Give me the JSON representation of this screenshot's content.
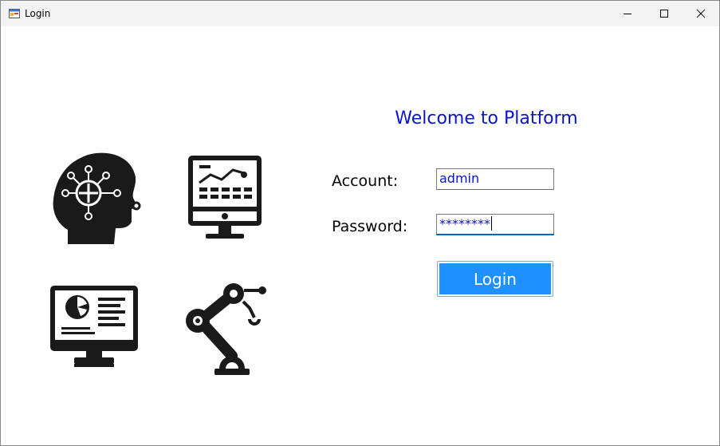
{
  "window": {
    "title": "Login",
    "controls": {
      "minimize": "minimize-icon",
      "maximize": "maximize-icon",
      "close": "close-icon"
    }
  },
  "illustrations": [
    {
      "icon": "ai-brain-icon"
    },
    {
      "icon": "analytics-monitor-icon"
    },
    {
      "icon": "dashboard-monitor-icon"
    },
    {
      "icon": "robot-arm-icon"
    }
  ],
  "form": {
    "welcome": "Welcome to Platform",
    "account_label": "Account:",
    "account_value": "admin",
    "password_label": "Password:",
    "password_value": "********",
    "login_label": "Login"
  },
  "colors": {
    "welcome_text": "#0a14c8",
    "input_text": "#0a14c8",
    "login_button": "#1e90ff",
    "focus_underline": "#0067c0"
  }
}
